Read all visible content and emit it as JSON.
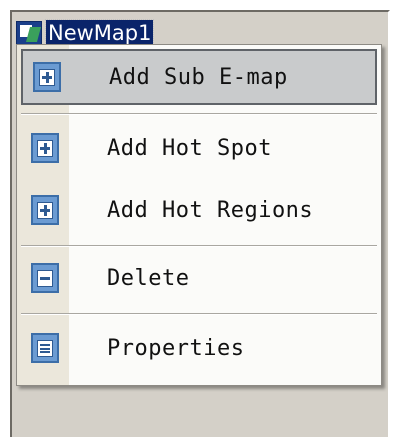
{
  "tree": {
    "node_label": "NewMap1",
    "node_icon": "emap-icon"
  },
  "context_menu": {
    "items": [
      {
        "label": "Add Sub E-map",
        "icon": "add-page-icon",
        "highlighted": true
      },
      {
        "label": "Add Hot Spot",
        "icon": "add-page-icon",
        "highlighted": false
      },
      {
        "label": "Add Hot Regions",
        "icon": "add-page-icon",
        "highlighted": false
      },
      {
        "label": "Delete",
        "icon": "remove-page-icon",
        "highlighted": false
      },
      {
        "label": "Properties",
        "icon": "properties-icon",
        "highlighted": false
      }
    ]
  },
  "colors": {
    "selection_bg": "#0a246a",
    "menu_bg": "#fbfbf9",
    "gutter_bg": "#ebe7db",
    "highlight_bg": "#c9cbcc",
    "icon_blue": "#6b9bd2"
  }
}
